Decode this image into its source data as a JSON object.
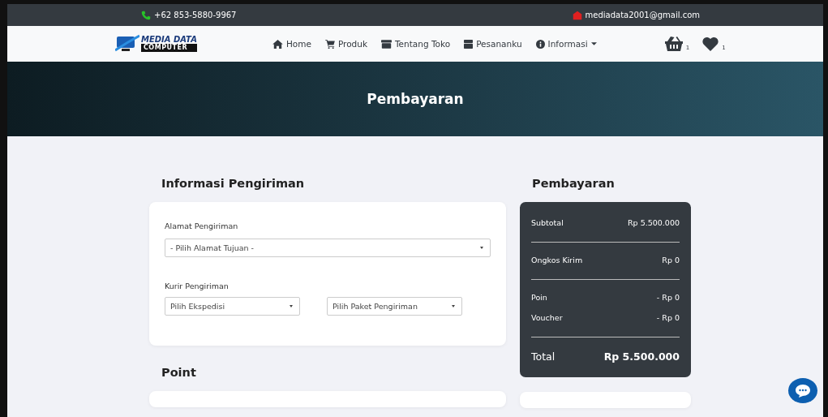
{
  "topbar": {
    "phone": "+62 853-5880-9967",
    "email": "mediadata2001@gmail.com"
  },
  "navbar": {
    "logo": "MEDIA DATA",
    "logo_sub": "COMPUTER",
    "items": [
      {
        "label": "Home",
        "dropdown": false
      },
      {
        "label": "Produk",
        "dropdown": false
      },
      {
        "label": "Tentang Toko",
        "dropdown": false
      },
      {
        "label": "Pesananku",
        "dropdown": false
      },
      {
        "label": "Informasi",
        "dropdown": true
      }
    ],
    "cart_count": "1",
    "wishlist_count": "1"
  },
  "hero": {
    "title": "Pembayaran"
  },
  "shipping": {
    "heading": "Informasi Pengiriman",
    "address_label": "Alamat Pengiriman",
    "address_placeholder": "- Pilih Alamat Tujuan -",
    "courier_label": "Kurir Pengiriman",
    "courier_placeholder": "Pilih Ekspedisi",
    "package_placeholder": "Pilih Paket Pengiriman"
  },
  "point": {
    "heading": "Point"
  },
  "payment": {
    "heading": "Pembayaran",
    "groups": [
      [
        {
          "label": "Subtotal",
          "value": "Rp 5.500.000"
        }
      ],
      [
        {
          "label": "Ongkos Kirim",
          "value": "Rp 0"
        }
      ],
      [
        {
          "label": "Poin",
          "value": "- Rp 0"
        },
        {
          "label": "Voucher",
          "value": "- Rp 0"
        }
      ]
    ],
    "total_label": "Total",
    "total_value": "Rp 5.500.000"
  }
}
